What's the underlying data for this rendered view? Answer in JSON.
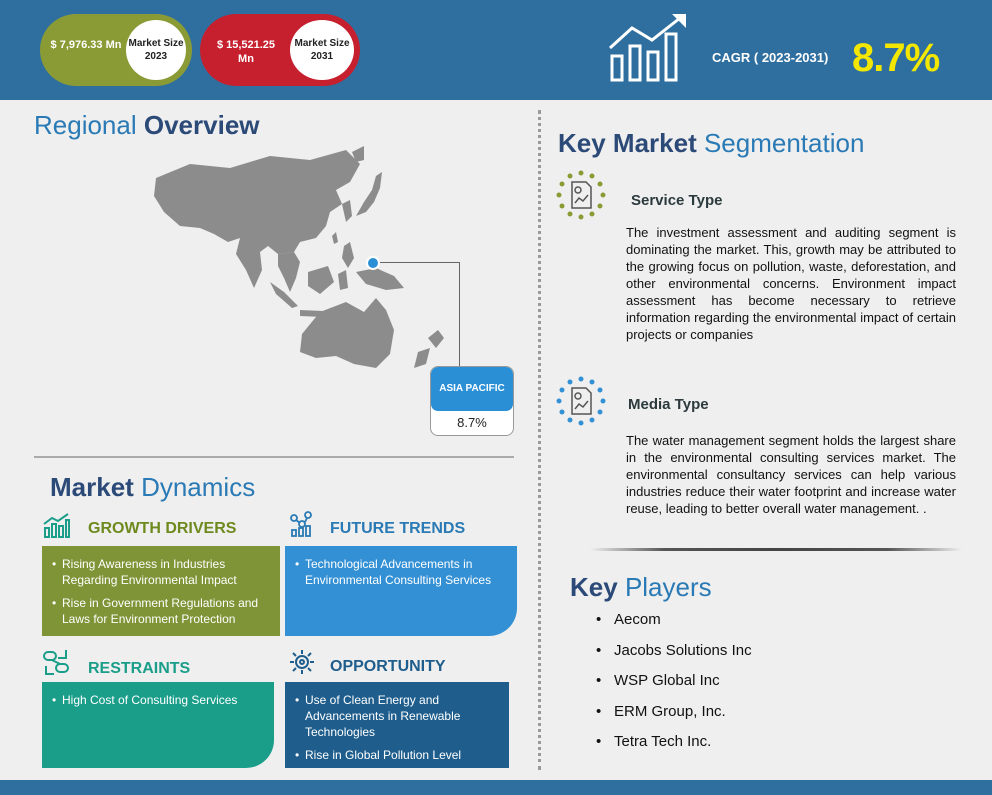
{
  "header": {
    "market_2023": {
      "value": "$ 7,976.33 Mn",
      "label": "Market Size 2023"
    },
    "market_2031": {
      "value": "$ 15,521.25 Mn",
      "label": "Market Size 2031"
    },
    "cagr_label": "CAGR ( 2023-2031)",
    "cagr_value": "8.7%"
  },
  "regional": {
    "title_light": "Regional",
    "title_bold": "Overview",
    "region_name": "ASIA PACIFIC",
    "region_value": "8.7%"
  },
  "dynamics": {
    "title_bold": "Market",
    "title_light": "Dynamics",
    "growth_drivers": {
      "heading": "GROWTH DRIVERS",
      "items": [
        "Rising Awareness in Industries Regarding Environmental Impact",
        "Rise in Government Regulations and Laws for Environment Protection"
      ]
    },
    "future_trends": {
      "heading": "FUTURE TRENDS",
      "items": [
        "Technological Advancements in Environmental Consulting Services"
      ]
    },
    "restraints": {
      "heading": "RESTRAINTS",
      "items": [
        "High Cost of Consulting Services"
      ]
    },
    "opportunity": {
      "heading": "OPPORTUNITY",
      "items": [
        "Use of Clean Energy and Advancements in Renewable Technologies",
        "Rise in Global Pollution Level"
      ]
    }
  },
  "segmentation": {
    "title_bold": "Key Market",
    "title_light": "Segmentation",
    "service_type": {
      "heading": "Service Type",
      "text": "The investment assessment and auditing segment is dominating the market. This, growth may be attributed to the growing focus on pollution, waste, deforestation, and other environmental concerns. Environment impact assessment has become necessary to retrieve information regarding the environmental impact of certain projects or companies"
    },
    "media_type": {
      "heading": "Media Type",
      "text": "The water management segment holds the largest share in the environmental consulting services market. The environmental consultancy services can help various industries reduce their water footprint and increase water reuse, leading to better overall water management. ."
    }
  },
  "players": {
    "title_bold": "Key",
    "title_light": "Players",
    "items": [
      "Aecom",
      "Jacobs Solutions Inc",
      "WSP Global Inc",
      "ERM Group, Inc.",
      "Tetra Tech Inc."
    ]
  },
  "colors": {
    "header_bg": "#2f6f9f",
    "cagr": "#f3e600",
    "green": "#7f9436",
    "red": "#c6202e",
    "blue": "#3390d4",
    "teal": "#1a9e8a",
    "navy": "#1f5e8c"
  },
  "icons": [
    "growth-chart-icon",
    "bar-chart-icon",
    "trend-nodes-icon",
    "chain-restraint-icon",
    "gear-opportunity-icon",
    "document-chart-icon",
    "map-pin-icon"
  ]
}
